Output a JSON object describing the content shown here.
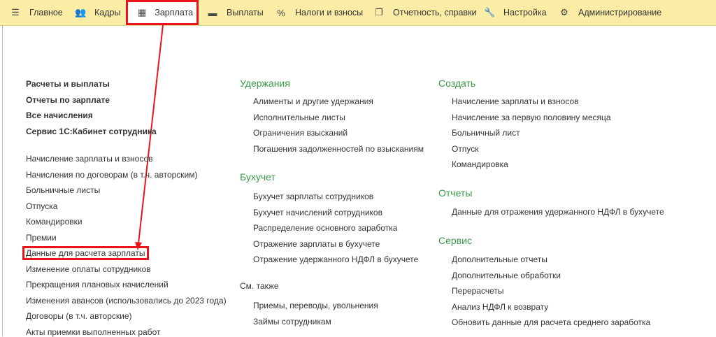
{
  "topbar": {
    "tabs": [
      {
        "label": "Главное",
        "icon": "menu-icon"
      },
      {
        "label": "Кадры",
        "icon": "people-icon"
      },
      {
        "label": "Зарплата",
        "icon": "calculator-icon",
        "active": true
      },
      {
        "label": "Выплаты",
        "icon": "card-icon"
      },
      {
        "label": "Налоги и взносы",
        "icon": "percent-icon"
      },
      {
        "label": "Отчетность, справки",
        "icon": "documents-icon"
      },
      {
        "label": "Настройка",
        "icon": "wrench-icon"
      },
      {
        "label": "Администрирование",
        "icon": "gear-icon"
      }
    ]
  },
  "left": {
    "bold": [
      "Расчеты и выплаты",
      "Отчеты по зарплате",
      "Все начисления",
      "Сервис 1С:Кабинет сотрудника"
    ],
    "items": [
      "Начисление зарплаты и взносов",
      "Начисления по договорам (в т.ч. авторским)",
      "Больничные листы",
      "Отпуска",
      "Командировки",
      "Премии",
      "Данные для расчета зарплаты",
      "Изменение оплаты сотрудников",
      "Прекращения плановых начислений",
      "Изменения авансов (использовались до 2023 года)",
      "Договоры (в т.ч. авторские)",
      "Акты приемки выполненных работ"
    ]
  },
  "middle": {
    "deductions": {
      "title": "Удержания",
      "items": [
        "Алименты и другие удержания",
        "Исполнительные листы",
        "Ограничения взысканий",
        "Погашения задолженностей по взысканиям"
      ]
    },
    "accounting": {
      "title": "Бухучет",
      "items": [
        "Бухучет зарплаты сотрудников",
        "Бухучет начислений сотрудников",
        "Распределение основного заработка",
        "Отражение зарплаты в бухучете",
        "Отражение удержанного НДФЛ в бухучете"
      ]
    },
    "see_also": {
      "title": "См. также",
      "items": [
        "Приемы, переводы, увольнения",
        "Займы сотрудникам"
      ]
    }
  },
  "right": {
    "create": {
      "title": "Создать",
      "items": [
        "Начисление зарплаты и взносов",
        "Начисление за первую половину месяца",
        "Больничный лист",
        "Отпуск",
        "Командировка"
      ]
    },
    "reports": {
      "title": "Отчеты",
      "items": [
        "Данные для отражения удержанного НДФЛ в бухучете"
      ]
    },
    "service": {
      "title": "Сервис",
      "items": [
        "Дополнительные отчеты",
        "Дополнительные обработки",
        "Перерасчеты",
        "Анализ НДФЛ к возврату",
        "Обновить данные для расчета среднего заработка"
      ]
    }
  },
  "colors": {
    "topbar": "#fbeda6",
    "highlight": "#e8161c",
    "section_heading": "#3a9a48"
  }
}
